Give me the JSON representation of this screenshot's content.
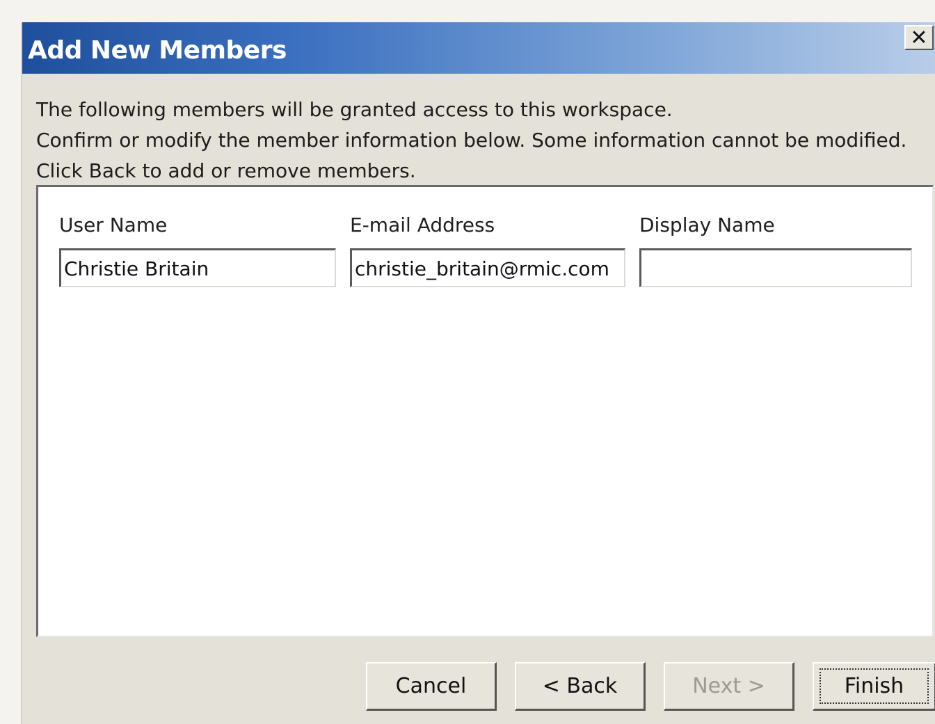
{
  "dialog": {
    "title": "Add New Members",
    "close_label": "✕"
  },
  "instructions": {
    "line1": "The following members will be granted access to this workspace.",
    "line2": "Confirm or modify the member information below. Some information cannot be modified.",
    "line3": "Click Back to add or remove members."
  },
  "members": {
    "user_name_label": "User Name",
    "email_label": "E-mail Address",
    "display_name_label": "Display Name",
    "rows": [
      {
        "user_name": "Christie Britain",
        "email": "christie_britain@rmic.com",
        "display_name": ""
      }
    ]
  },
  "buttons": {
    "cancel": "Cancel",
    "back": "< Back",
    "next": "Next >",
    "finish": "Finish"
  },
  "colors": {
    "titlebar_start": "#1f4f9c",
    "titlebar_end": "#b9cde9",
    "dialog_face": "#e4e1d8"
  }
}
